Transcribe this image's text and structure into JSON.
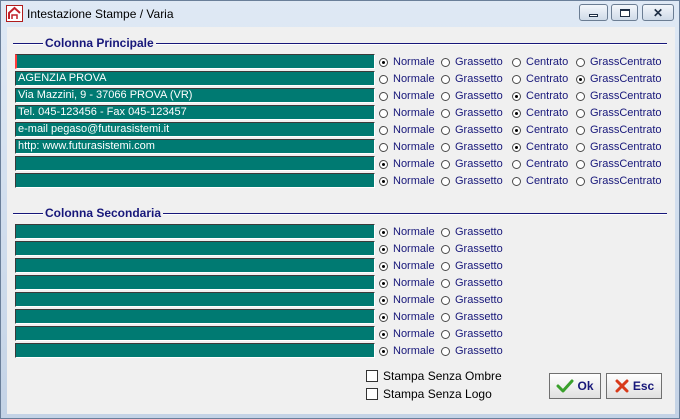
{
  "window": {
    "title": "Intestazione Stampe / Varia"
  },
  "primary": {
    "label": "Colonna Principale",
    "options": [
      "Normale",
      "Grassetto",
      "Centrato",
      "GrassCentrato"
    ],
    "rows": [
      {
        "value": "",
        "selected": 0
      },
      {
        "value": "AGENZIA PROVA",
        "selected": 3
      },
      {
        "value": "Via Mazzini, 9 - 37066 PROVA (VR)",
        "selected": 2
      },
      {
        "value": "Tel. 045-123456 - Fax 045-123457",
        "selected": 2
      },
      {
        "value": "e-mail pegaso@futurasistemi.it",
        "selected": 2
      },
      {
        "value": "http: www.futurasistemi.com",
        "selected": 2
      },
      {
        "value": "",
        "selected": 0
      },
      {
        "value": "",
        "selected": 0
      }
    ]
  },
  "secondary": {
    "label": "Colonna Secondaria",
    "options": [
      "Normale",
      "Grassetto"
    ],
    "rows": [
      {
        "value": "",
        "selected": 0
      },
      {
        "value": "",
        "selected": 0
      },
      {
        "value": "",
        "selected": 0
      },
      {
        "value": "",
        "selected": 0
      },
      {
        "value": "",
        "selected": 0
      },
      {
        "value": "",
        "selected": 0
      },
      {
        "value": "",
        "selected": 0
      },
      {
        "value": "",
        "selected": 0
      }
    ]
  },
  "checks": {
    "no_shadow": {
      "label": "Stampa Senza Ombre",
      "checked": false
    },
    "no_logo": {
      "label": "Stampa Senza Logo",
      "checked": false
    }
  },
  "buttons": {
    "ok": "Ok",
    "esc": "Esc"
  }
}
